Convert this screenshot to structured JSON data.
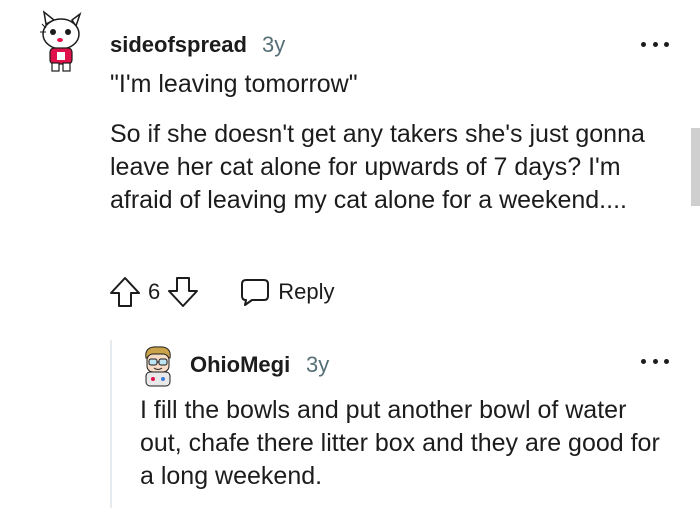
{
  "comments": [
    {
      "username": "sideofspread",
      "age": "3y",
      "avatar": "cat-avatar",
      "paragraphs": [
        "\"I'm leaving tomorrow\"",
        "So if she doesn't get any takers she's just gonna leave her cat alone for upwards of 7 days? I'm afraid of leaving my cat alone for a weekend...."
      ],
      "score": "6",
      "reply_label": "Reply"
    },
    {
      "username": "OhioMegi",
      "age": "3y",
      "avatar": "glasses-avatar",
      "paragraphs": [
        "I fill the bowls and put another bowl of water out, chafe there litter box and they are good for a long weekend."
      ]
    }
  ],
  "icons": {
    "upvote": "arrow-up-outline-icon",
    "downvote": "arrow-down-outline-icon",
    "reply": "speech-bubble-icon",
    "more": "horizontal-ellipsis-icon"
  },
  "colors": {
    "text": "#1c1c1c",
    "meta": "#576f76",
    "thread_line": "#e5ebee",
    "avatar_accent": "#e0114a"
  }
}
